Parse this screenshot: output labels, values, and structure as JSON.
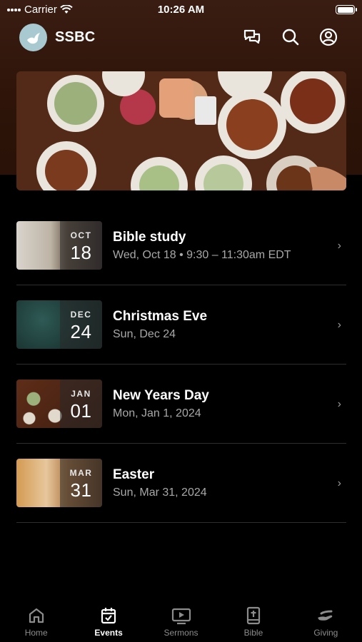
{
  "status_bar": {
    "carrier": "Carrier",
    "time": "10:26 AM"
  },
  "header": {
    "app_name": "SSBC",
    "icons": [
      "chat-icon",
      "search-icon",
      "account-icon"
    ]
  },
  "banner": {
    "image": "dinner-table-photo"
  },
  "events": [
    {
      "month": "OCT",
      "day": "18",
      "title": "Bible study",
      "subtitle": "Wed, Oct 18 • 9:30 – 11:30am EDT"
    },
    {
      "month": "DEC",
      "day": "24",
      "title": "Christmas Eve",
      "subtitle": "Sun, Dec 24"
    },
    {
      "month": "JAN",
      "day": "01",
      "title": "New Years Day",
      "subtitle": "Mon, Jan 1, 2024"
    },
    {
      "month": "MAR",
      "day": "31",
      "title": "Easter",
      "subtitle": "Sun, Mar 31, 2024"
    }
  ],
  "tabs": [
    {
      "label": "Home",
      "icon": "home-icon",
      "active": false
    },
    {
      "label": "Events",
      "icon": "calendar-icon",
      "active": true
    },
    {
      "label": "Sermons",
      "icon": "video-icon",
      "active": false
    },
    {
      "label": "Bible",
      "icon": "bible-icon",
      "active": false
    },
    {
      "label": "Giving",
      "icon": "giving-icon",
      "active": false
    }
  ],
  "colors": {
    "header_brown": "#3a1d12",
    "logo_teal": "#a8c9cf",
    "background": "#000000"
  }
}
